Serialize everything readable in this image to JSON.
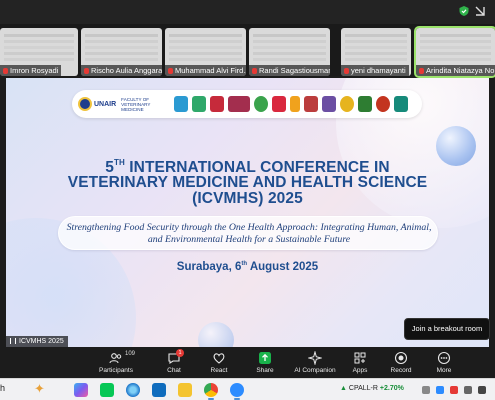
{
  "participants": [
    {
      "name": "Imron Rosyadi",
      "muted": true
    },
    {
      "name": "Rischo Aulia Anggara",
      "muted": true
    },
    {
      "name": "Muhammad Alvi Fird…",
      "muted": true
    },
    {
      "name": "Randi Sagastiousman…",
      "muted": true
    },
    {
      "name": "yeni dhamayanti",
      "muted": true
    },
    {
      "name": "Arindita Niatazya No…",
      "muted": true
    }
  ],
  "share": {
    "logo": {
      "name": "UNAIR",
      "faculty": "FACULTY OF VETERINARY MEDICINE"
    },
    "title_line1_num": "5",
    "title_line1_sup": "TH",
    "title_line1_rest": " INTERNATIONAL CONFERENCE IN",
    "title_line2": "VETERINARY MEDICINE AND HEALTH SCIENCE",
    "title_line3": "(ICVMHS) 2025",
    "subtitle": "Strengthening Food Security through the One Health Approach: Integrating Human, Animal, and Environmental Health for a Sustainable Future",
    "place_pre": "Surabaya, 6",
    "place_sup": "th",
    "place_post": " August 2025",
    "presenter_label": "ICVMHS 2025"
  },
  "tooltip": "Join a breakout room",
  "toolbar": {
    "participants_label": "Participants",
    "participants_count": "109",
    "chat_label": "Chat",
    "chat_badge": "1",
    "react_label": "React",
    "share_label": "Share",
    "ai_label": "AI Companion",
    "apps_label": "Apps",
    "record_label": "Record",
    "more_label": "More"
  },
  "taskbar": {
    "search_fragment": "h",
    "ticker_symbol": "CPALL-R",
    "ticker_change": "+2.70%"
  },
  "colors": {
    "title_blue": "#1f4e8f",
    "share_green": "#19b24b",
    "mute_red": "#e53935"
  }
}
